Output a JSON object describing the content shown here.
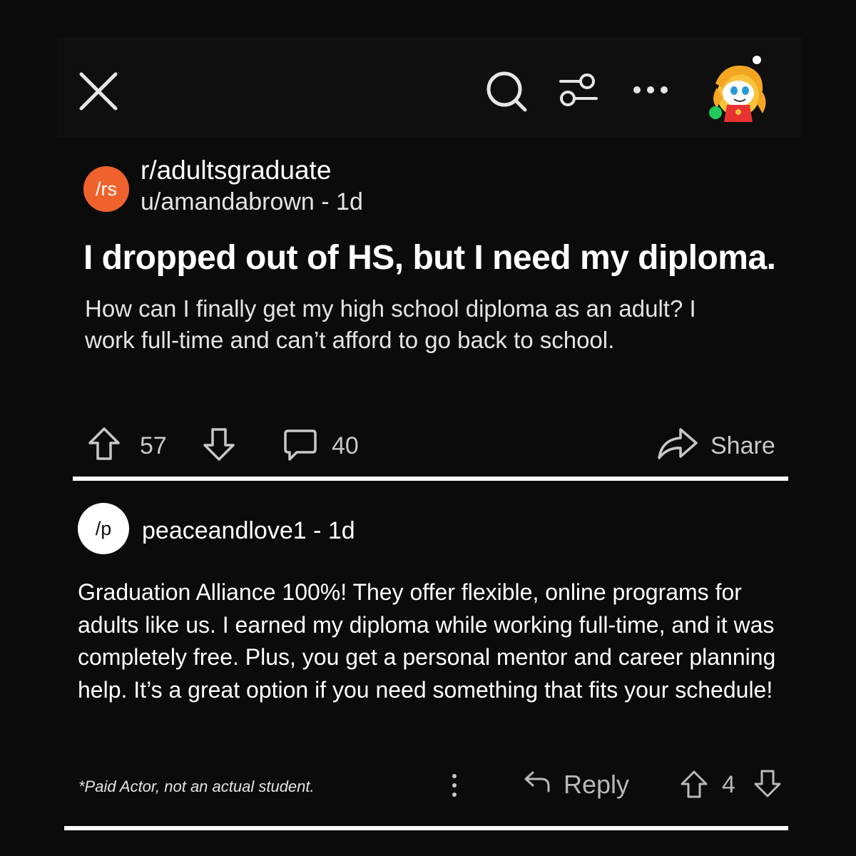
{
  "topbar": {
    "close_icon": "close-icon",
    "search_icon": "search-icon",
    "filter_icon": "filter-icon",
    "more_icon": "more-icon",
    "avatar_icon": "snoo-avatar",
    "online_status_color": "#23c85a"
  },
  "post": {
    "subreddit_icon_text": "/rs",
    "subreddit_icon_color": "#f0622d",
    "subreddit": "r/adultsgraduate",
    "author_meta": "u/amandabrown - 1d",
    "title": "I dropped out of HS, but I need my diploma.",
    "body": "How can I finally get my high school diploma as an adult? I work full-time and can’t afford to go back to school.",
    "upvotes": "57",
    "comments": "40",
    "share_label": "Share"
  },
  "comment": {
    "avatar_text": "/p",
    "meta": "peaceandlove1 - 1d",
    "body": "Graduation Alliance 100%! They offer flexible, online programs for adults like us. I earned my diploma while working full-time, and it was completely free. Plus, you get a personal mentor and career planning help. It’s a great option if you need something that fits your schedule!",
    "disclaimer": "*Paid Actor, not an actual student.",
    "reply_label": "Reply",
    "votes": "4"
  }
}
